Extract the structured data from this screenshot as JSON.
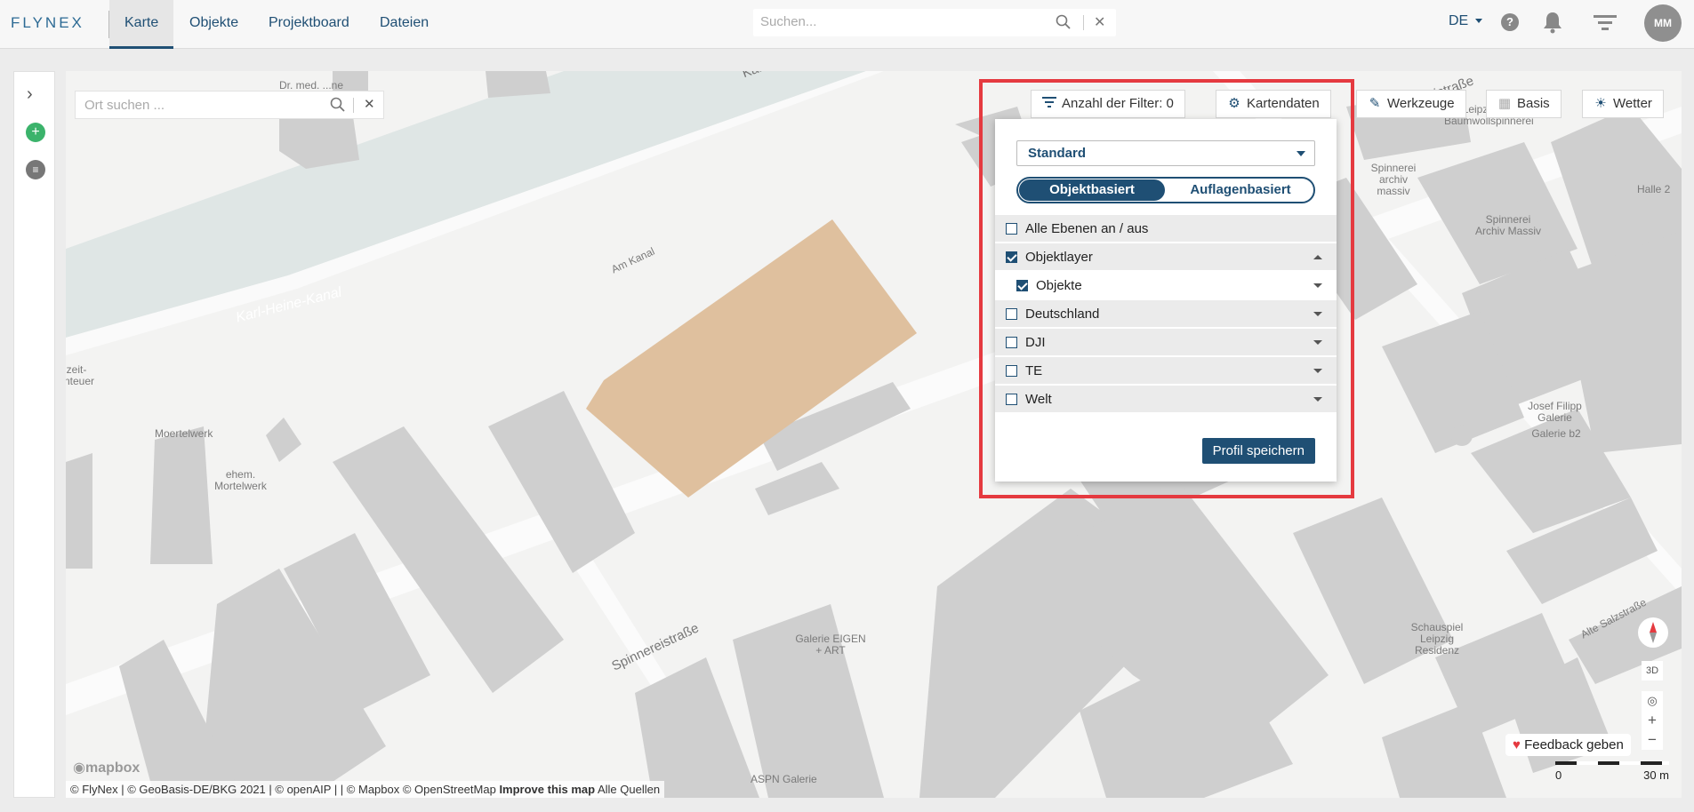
{
  "nav": {
    "logo": "FLYNEX",
    "tabs": [
      {
        "label": "Karte",
        "active": true
      },
      {
        "label": "Objekte",
        "active": false
      },
      {
        "label": "Projektboard",
        "active": false
      },
      {
        "label": "Dateien",
        "active": false
      }
    ],
    "search_placeholder": "Suchen...",
    "language": "DE",
    "help": "?",
    "avatar_initials": "MM"
  },
  "map": {
    "place_search_placeholder": "Ort suchen ...",
    "toolbar": {
      "filter_count_label": "Anzahl der Filter: 0",
      "map_data_label": "Kartendaten",
      "tools_label": "Werkzeuge",
      "base_label": "Basis",
      "weather_label": "Wetter"
    },
    "labels": [
      {
        "text": "Dr. med. ...ne"
      },
      {
        "text": "Kan..."
      },
      {
        "text": "Spinnereistraße"
      },
      {
        "text": "Leipziger Baumwollspinnerei"
      },
      {
        "text": "Spinnerei archiv massiv"
      },
      {
        "text": "Halle 2"
      },
      {
        "text": "Spinnerei Archiv Massiv"
      },
      {
        "text": "Am Kanal"
      },
      {
        "text": "Karl-Heine-Kanal"
      },
      {
        "text": "...izeit- ...nteuer"
      },
      {
        "text": "Moertelwerk"
      },
      {
        "text": "ehem. Mortelwerk"
      },
      {
        "text": "Josef Filipp Galerie"
      },
      {
        "text": "Galerie b2"
      },
      {
        "text": "Schauspiel Leipzig Residenz"
      },
      {
        "text": "Alte Salzstraße"
      },
      {
        "text": "Galerie EIGEN + ART"
      },
      {
        "text": "ASPN Galerie"
      }
    ],
    "controls": {
      "three_d": "3D",
      "feedback": "Feedback geben",
      "scale_start": "0",
      "scale_end": "30 m",
      "mapbox": "mapbox"
    },
    "attribution": {
      "text": "© FlyNex | © GeoBasis-DE/BKG 2021 | © openAIP | | © Mapbox © OpenStreetMap",
      "improve": "Improve this map",
      "sources": "Alle Quellen"
    }
  },
  "layer_panel": {
    "profile": "Standard",
    "mode_object": "Objektbasiert",
    "mode_overlay": "Auflagenbasiert",
    "rows": [
      {
        "label": "Alle Ebenen an / aus",
        "checked": false
      },
      {
        "label": "Objektlayer",
        "checked": true
      },
      {
        "label": "Objekte",
        "checked": true
      },
      {
        "label": "Deutschland",
        "checked": false
      },
      {
        "label": "DJI",
        "checked": false
      },
      {
        "label": "TE",
        "checked": false
      },
      {
        "label": "Welt",
        "checked": false
      }
    ],
    "save_label": "Profil speichern"
  },
  "colors": {
    "primary": "#1f4f74",
    "highlight": "#e53a40",
    "building": "#cfcfcf",
    "parcel": "#dfc09e",
    "water": "#dfe6e5"
  }
}
